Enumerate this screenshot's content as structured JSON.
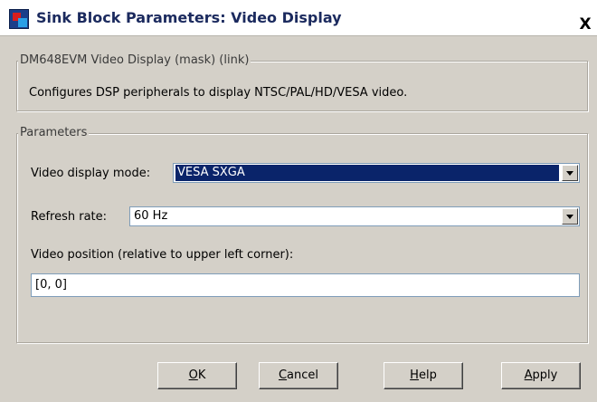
{
  "window": {
    "title": "Sink Block Parameters: Video Display",
    "close_label": "X"
  },
  "mask": {
    "legend": "DM648EVM Video Display (mask) (link)",
    "description": "Configures DSP peripherals to display NTSC/PAL/HD/VESA video."
  },
  "parameters": {
    "legend": "Parameters",
    "display_mode": {
      "label": "Video display mode:",
      "value": "VESA SXGA"
    },
    "refresh_rate": {
      "label": "Refresh rate:",
      "value": "60 Hz"
    },
    "position": {
      "label": "Video position (relative to upper left corner):",
      "value": "[0, 0]"
    }
  },
  "buttons": {
    "ok": {
      "mnemonic": "O",
      "rest": "K"
    },
    "cancel": {
      "mnemonic": "C",
      "rest": "ancel"
    },
    "help": {
      "mnemonic": "H",
      "rest": "elp"
    },
    "apply": {
      "mnemonic": "A",
      "rest": "pply"
    }
  }
}
